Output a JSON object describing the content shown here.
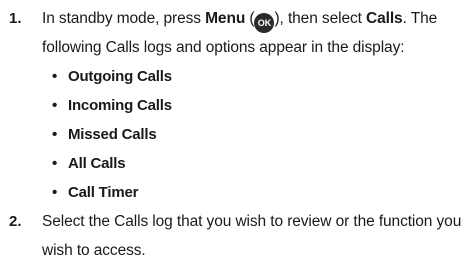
{
  "steps": [
    {
      "number": "1.",
      "parts": {
        "a": "In standby mode, press ",
        "menu": "Menu",
        "b": " (",
        "key": "OK",
        "c": "), then select ",
        "calls": "Calls",
        "d": ". The following Calls logs and options appear in the display:"
      }
    },
    {
      "number": "2.",
      "text": "Select the Calls log that you wish to review or the function you wish to access."
    }
  ],
  "bullet_symbol": "•",
  "bullets": [
    "Outgoing Calls",
    "Incoming Calls",
    "Missed Calls",
    "All Calls",
    "Call Timer"
  ]
}
